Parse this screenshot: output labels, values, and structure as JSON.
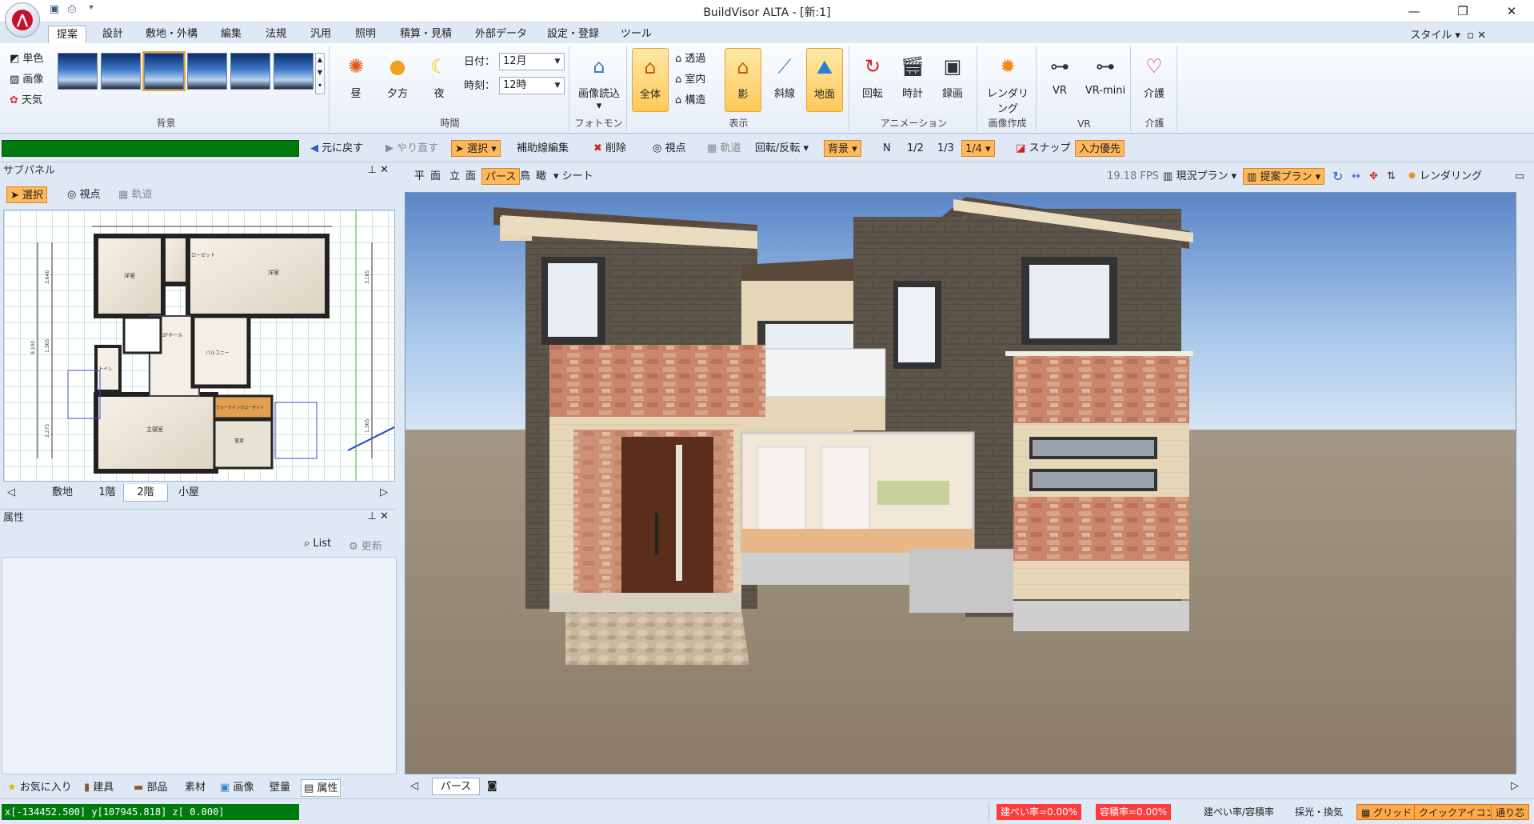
{
  "window": {
    "title": "BuildVisor ALTA - [新:1]",
    "minimize": "—",
    "maximize": "❐",
    "close": "✕"
  },
  "ribbon_tabs": [
    "提案",
    "設計",
    "敷地・外構",
    "編集",
    "法規",
    "汎用",
    "照明",
    "積算・見積",
    "外部データ",
    "設定・登録",
    "ツール"
  ],
  "style_menu": "スタイル",
  "ribbon": {
    "bg": {
      "label": "背景",
      "mono": "単色",
      "image": "画像",
      "weather": "天気"
    },
    "time": {
      "label": "時間",
      "noon": "昼",
      "evening": "夕方",
      "night": "夜",
      "date_label": "日付：",
      "date_value": "12月",
      "hour_label": "時刻：",
      "hour_value": "12時"
    },
    "photomon": {
      "label": "フォトモン",
      "load": "画像読込"
    },
    "display": {
      "label": "表示",
      "all": "全体",
      "transparent": "透過",
      "interior": "室内",
      "structure": "構造",
      "shadow": "影",
      "slope": "斜線",
      "ground": "地面"
    },
    "animation": {
      "label": "アニメーション",
      "rotate": "回転",
      "clock": "時計",
      "record": "録画"
    },
    "image_create": {
      "label": "画像作成",
      "render": "レンダリング"
    },
    "vr": {
      "label": "VR",
      "vr": "VR",
      "vrmini": "VR-mini"
    },
    "care": {
      "label": "介護",
      "care": "介護"
    }
  },
  "toolbar2": {
    "undo": "元に戻す",
    "redo": "やり直す",
    "select": "選択",
    "aux_edit": "補助線編集",
    "delete": "削除",
    "viewpoint": "視点",
    "track": "軌道",
    "rotate_flip": "回転/反転",
    "background": "背景",
    "n": "N",
    "half": "1/2",
    "third": "1/3",
    "quarter": "1/4",
    "snap": "スナップ",
    "input_priority": "入力優先"
  },
  "subpanel": {
    "title": "サブパネル",
    "select": "選択",
    "viewpoint": "視点",
    "track": "軌道",
    "floor_tabs": [
      "敷地",
      "1階",
      "2階",
      "小屋"
    ],
    "plan_labels": {
      "bed1": "洋室",
      "closet": "クローゼット",
      "bed2": "洋室",
      "hall": "2Fホール",
      "balcony": "バルコニー",
      "toilet": "トイレ",
      "master": "主寝室",
      "wic": "ウォークインクローゼット",
      "study": "書斎"
    },
    "dims": {
      "d1": "3,640",
      "d2": "9,100",
      "d3": "1,365",
      "d4": "2,275",
      "d5": "3,185",
      "d6": "1,365"
    }
  },
  "properties": {
    "title": "属性",
    "list": "List",
    "refresh": "更新"
  },
  "bottom_tabs": [
    "お気に入り",
    "建具",
    "部品",
    "素材",
    "画像",
    "壁量",
    "属性"
  ],
  "view_toolbar": {
    "plan": "平",
    "elev_face": "面",
    "elev": "立",
    "elev2": "面",
    "perspective": "パース",
    "bird": "鳥",
    "overlook": "瞰",
    "sheet": "シート",
    "fps": "19.18 FPS",
    "current_plan": "現況プラン",
    "proposal_plan": "提案プラン",
    "rendering": "レンダリング"
  },
  "view_bottom": {
    "tab": "パース"
  },
  "status": {
    "coords": "x[-134452.500] y[107945.818] z[     0.000]",
    "coverage": "建ぺい率=0.00%",
    "far": "容積率=0.00%",
    "ratio_label": "建ぺい率/容積率",
    "light": "採光・換気",
    "grid": "グリッド",
    "quick_icon": "クイックアイコン",
    "fit": "通り芯"
  }
}
